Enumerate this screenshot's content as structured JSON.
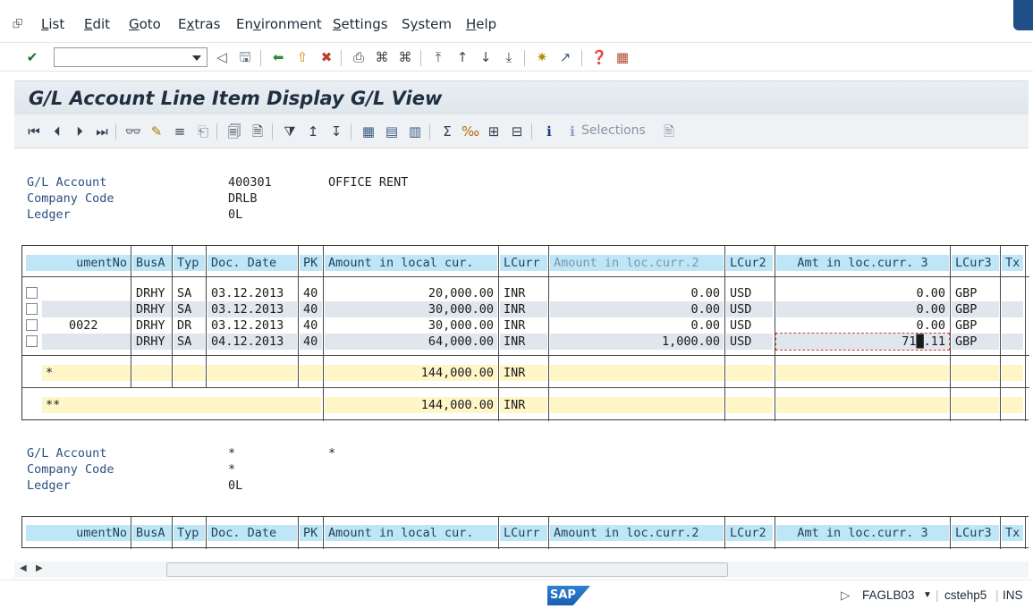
{
  "menu": {
    "items": [
      "List",
      "Edit",
      "Goto",
      "Extras",
      "Environment",
      "Settings",
      "System",
      "Help"
    ],
    "underline": [
      "L",
      "E",
      "G",
      "x",
      "v",
      "S",
      "y",
      "H"
    ]
  },
  "toolbar": {
    "command_value": ""
  },
  "title": "G/L Account Line Item Display G/L View",
  "app_toolbar": {
    "selections_label": "Selections"
  },
  "header1": {
    "gl_account_label": "G/L Account",
    "gl_account_value": "400301",
    "gl_account_text": "OFFICE RENT",
    "company_code_label": "Company Code",
    "company_code_value": "DRLB",
    "ledger_label": "Ledger",
    "ledger_value": "0L"
  },
  "columns": [
    "umentNo",
    "BusA",
    "Typ",
    "Doc. Date",
    "PK",
    "Amount in local cur.",
    "LCurr",
    "Amount in loc.curr.2",
    "LCur2",
    "Amt in loc.curr. 3",
    "LCur3",
    "Tx"
  ],
  "rows": [
    {
      "docno": "",
      "busa": "DRHY",
      "typ": "SA",
      "date": "03.12.2013",
      "pk": "40",
      "amt1": "20,000.00",
      "cur1": "INR",
      "amt2": "0.00",
      "cur2": "USD",
      "amt3": "0.00",
      "cur3": "GBP"
    },
    {
      "docno": "",
      "busa": "DRHY",
      "typ": "SA",
      "date": "03.12.2013",
      "pk": "40",
      "amt1": "30,000.00",
      "cur1": "INR",
      "amt2": "0.00",
      "cur2": "USD",
      "amt3": "0.00",
      "cur3": "GBP"
    },
    {
      "docno": "0022",
      "busa": "DRHY",
      "typ": "DR",
      "date": "03.12.2013",
      "pk": "40",
      "amt1": "30,000.00",
      "cur1": "INR",
      "amt2": "0.00",
      "cur2": "USD",
      "amt3": "0.00",
      "cur3": "GBP"
    },
    {
      "docno": "",
      "busa": "DRHY",
      "typ": "SA",
      "date": "04.12.2013",
      "pk": "40",
      "amt1": "64,000.00",
      "cur1": "INR",
      "amt2": "1,000.00",
      "cur2": "USD",
      "amt3": "71█.11",
      "cur3": "GBP"
    }
  ],
  "subtotal": {
    "marker": "*",
    "amount": "144,000.00",
    "currency": "INR"
  },
  "total": {
    "marker": "**",
    "amount": "144,000.00",
    "currency": "INR"
  },
  "header2": {
    "gl_account_label": "G/L Account",
    "gl_account_value": "*",
    "gl_account_text": "*",
    "company_code_label": "Company Code",
    "company_code_value": "*",
    "ledger_label": "Ledger",
    "ledger_value": "0L"
  },
  "columns2": [
    "umentNo",
    "BusA",
    "Typ",
    "Doc. Date",
    "PK",
    "Amount in local cur.",
    "LCurr",
    "Amount in loc.curr.2",
    "LCur2",
    "Amt in loc.curr. 3",
    "LCur3",
    "Tx"
  ],
  "status": {
    "logo": "SAP",
    "transaction": "FAGLB03",
    "server": "cstehp5",
    "mode": "INS"
  },
  "colors": {
    "header_cell": "#bfe6f7",
    "total_cell": "#fff6c8",
    "alt_row": "#dfe6ee",
    "title_text": "#1f2f40"
  }
}
